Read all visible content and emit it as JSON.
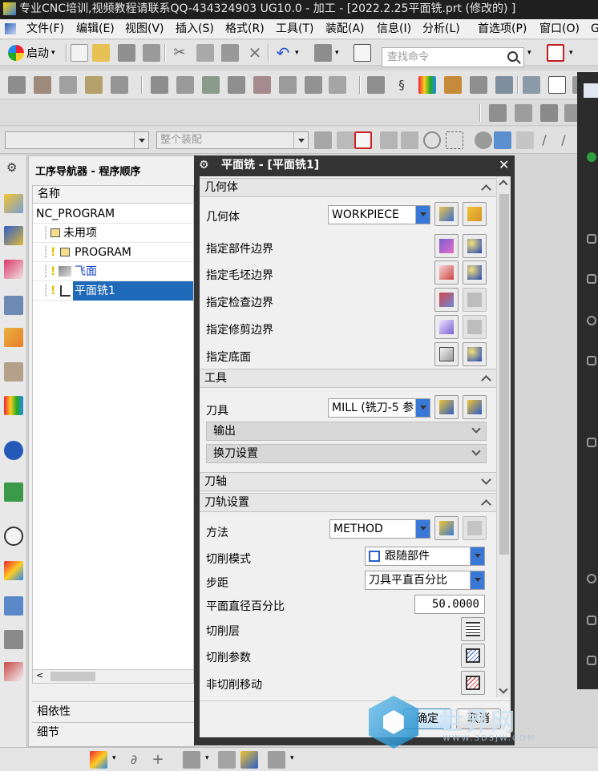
{
  "window": {
    "title": "专业CNC培训,视频教程请联系QQ-434324903 UG10.0 - 加工 - [2022.2.25平面铣.prt  (修改的) ]"
  },
  "menubar": {
    "items": [
      "文件(F)",
      "编辑(E)",
      "视图(V)",
      "插入(S)",
      "格式(R)",
      "工具(T)",
      "装配(A)",
      "信息(I)",
      "分析(L)",
      "首选项(P)",
      "窗口(O)",
      "G"
    ]
  },
  "toolbar": {
    "start_label": "启动",
    "search_placeholder": "查找命令"
  },
  "filter_bar": {
    "selection_scope": "整个装配"
  },
  "navigator": {
    "title": "工序导航器 - 程序顺序",
    "column_header": "名称",
    "rows": [
      "NC_PROGRAM",
      "未用项",
      "PROGRAM",
      "飞面",
      "平面铣1"
    ],
    "selected_row": "平面铣1",
    "bottom_sections": [
      "相依性",
      "细节"
    ]
  },
  "dialog": {
    "title": "平面铣 - [平面铣1]",
    "geometry": {
      "header": "几何体",
      "geometry_label": "几何体",
      "geometry_value": "WORKPIECE",
      "rows": [
        "指定部件边界",
        "指定毛坯边界",
        "指定检查边界",
        "指定修剪边界",
        "指定底面"
      ]
    },
    "tool": {
      "header": "工具",
      "tool_label": "刀具",
      "tool_value": "MILL (铣刀-5 参",
      "output_label": "输出",
      "tool_change_label": "换刀设置"
    },
    "tool_axis": {
      "header": "刀轴"
    },
    "path_settings": {
      "header": "刀轨设置",
      "method_label": "方法",
      "method_value": "METHOD",
      "cut_pattern_label": "切削模式",
      "cut_pattern_value": "跟随部件",
      "stepover_label": "步距",
      "stepover_value": "刀具平直百分比",
      "flat_diameter_label": "平面直径百分比",
      "flat_diameter_value": "50.0000",
      "cut_levels_label": "切削层",
      "cut_params_label": "切削参数",
      "non_cutting_label": "非切削移动"
    },
    "ok_label": "确定",
    "cancel_label": "取消"
  },
  "watermark": {
    "text": "世界网",
    "url": "WWW.3DSJW.COM"
  },
  "colors": {
    "selection": "#1e6ab8",
    "dialog_frame": "#343434",
    "link_blue": "#1a47c8"
  }
}
